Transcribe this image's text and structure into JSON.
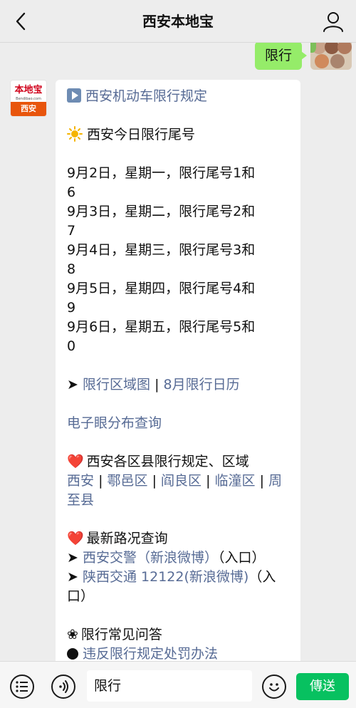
{
  "header": {
    "title": "西安本地宝"
  },
  "sent_message": {
    "text": "限行"
  },
  "bot": {
    "avatar_top": "本地宝",
    "avatar_small": "Bendibao.com",
    "avatar_bottom": "西安"
  },
  "message": {
    "rules_link": "西安机动车限行规定",
    "today_heading": "西安今日限行尾号",
    "schedule": [
      {
        "l1": "9月2日，星期一，限行尾号1和",
        "l2": "6"
      },
      {
        "l1": "9月3日，星期二，限行尾号2和",
        "l2": "7"
      },
      {
        "l1": "9月4日，星期三，限行尾号3和",
        "l2": "8"
      },
      {
        "l1": "9月5日，星期四，限行尾号4和",
        "l2": "9"
      },
      {
        "l1": "9月6日，星期五，限行尾号5和",
        "l2": "0"
      }
    ],
    "arrow": "➤",
    "area_map_link": "限行区域图",
    "separator": "|",
    "calendar_link": "8月限行日历",
    "camera_link": "电子眼分布查询",
    "districts_heading": "西安各区县限行规定、区域",
    "districts_line1": [
      {
        "label": "西安"
      },
      {
        "label": "鄠邑区"
      },
      {
        "label": "阎良区"
      },
      {
        "label": "临潼区"
      },
      {
        "label": "周"
      }
    ],
    "districts_line2": "至县",
    "traffic_heading": "最新路况查询",
    "traffic_link1": "西安交警（新浪微博）",
    "traffic_entry1": "（入口）",
    "traffic_link2": "陕西交通 12122(新浪微博)",
    "traffic_entry2_a": "（入",
    "traffic_entry2_b": "口）",
    "faq_heading": "限行常见问答",
    "faq_partial": "违反限行规定处罚办法"
  },
  "input": {
    "text": "限行",
    "send_label": "傳送"
  }
}
